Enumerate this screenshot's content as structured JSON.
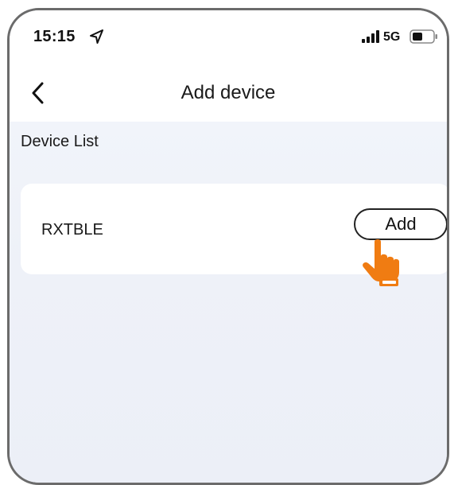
{
  "status_bar": {
    "time": "15:15",
    "network": "5G",
    "icons": [
      "location-arrow-icon",
      "signal-bars-icon",
      "battery-icon"
    ]
  },
  "nav": {
    "title": "Add device",
    "back_icon": "chevron-left-icon"
  },
  "device_list": {
    "title": "Device List",
    "items": [
      {
        "name": "RXTBLE",
        "action_label": "Add"
      }
    ]
  },
  "overlay": {
    "pointer_icon": "hand-pointer-icon"
  },
  "colors": {
    "frame_border": "#6b6b6b",
    "background": "#eef1f8",
    "card": "#ffffff",
    "pointer_orange": "#f07c12",
    "text": "#1a1a1a"
  }
}
